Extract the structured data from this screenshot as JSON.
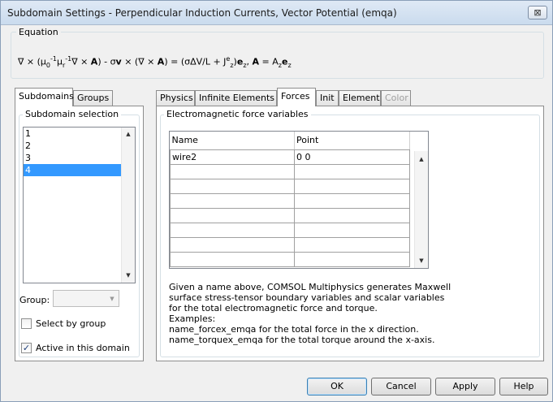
{
  "window": {
    "title": "Subdomain Settings - Perpendicular Induction Currents, Vector Potential (emqa)",
    "close_glyph": "⊠"
  },
  "equation": {
    "label": "Equation"
  },
  "left_tabs": {
    "tabs": [
      "Subdomains",
      "Groups"
    ],
    "selection_label": "Subdomain selection",
    "subdomains": [
      "1",
      "2",
      "3",
      "4"
    ],
    "selected_index": 3,
    "group_label": "Group:",
    "group_value": "",
    "select_by_group_label": "Select by group",
    "select_by_group_checked": false,
    "active_label": "Active in this domain",
    "active_checked": true
  },
  "right_tabs": {
    "tabs": [
      "Physics",
      "Infinite Elements",
      "Forces",
      "Init",
      "Element",
      "Color"
    ],
    "active_tab": "Forces",
    "disabled_tab": "Color",
    "group_label": "Electromagnetic force variables",
    "table": {
      "headers": [
        "Name",
        "Point"
      ],
      "rows": [
        [
          "wire2",
          "0 0"
        ],
        [
          "",
          ""
        ],
        [
          "",
          ""
        ],
        [
          "",
          ""
        ],
        [
          "",
          ""
        ],
        [
          "",
          ""
        ],
        [
          "",
          ""
        ],
        [
          "",
          ""
        ]
      ]
    },
    "help_lines": [
      "Given a name above, COMSOL Multiphysics generates Maxwell",
      "surface stress-tensor boundary variables and scalar variables",
      "for the total electromagnetic force and torque.",
      "Examples:",
      "name_forcex_emqa for the total force in the x direction.",
      "name_torquex_emqa for the total torque around the x-axis."
    ]
  },
  "buttons": {
    "ok": "OK",
    "cancel": "Cancel",
    "apply": "Apply",
    "help": "Help"
  },
  "icons": {
    "close": "close-icon",
    "scroll_up": "scroll-up-arrow-icon",
    "scroll_down": "scroll-down-arrow-icon",
    "dropdown": "chevron-down-icon",
    "check": "checkmark-icon"
  }
}
